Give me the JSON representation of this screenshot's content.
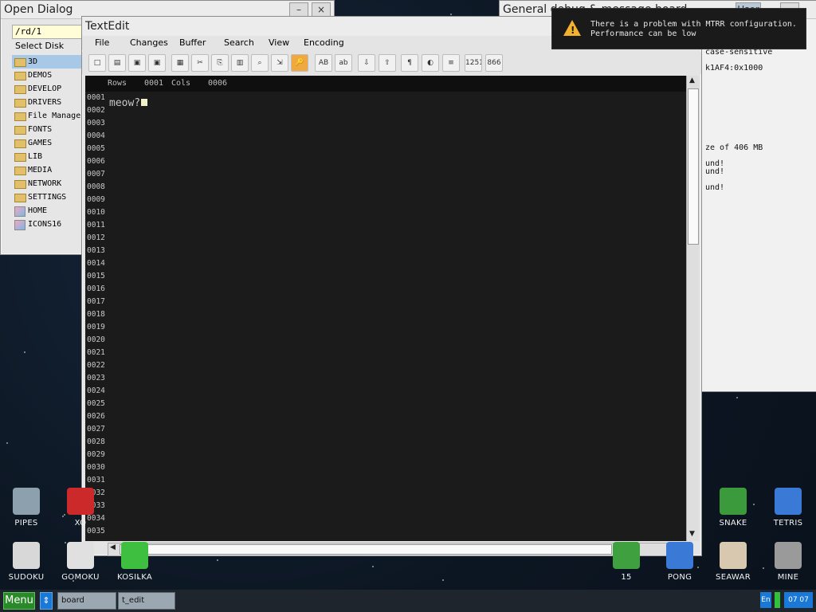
{
  "open_dialog": {
    "title": "Open Dialog",
    "path": "/rd/1",
    "select_disk": "Select Disk",
    "items": [
      {
        "name": "3D",
        "type": "folder",
        "selected": true
      },
      {
        "name": "DEMOS",
        "type": "folder"
      },
      {
        "name": "DEVELOP",
        "type": "folder"
      },
      {
        "name": "DRIVERS",
        "type": "folder"
      },
      {
        "name": "File Manage",
        "type": "folder"
      },
      {
        "name": "FONTS",
        "type": "folder"
      },
      {
        "name": "GAMES",
        "type": "folder"
      },
      {
        "name": "LIB",
        "type": "folder"
      },
      {
        "name": "MEDIA",
        "type": "folder"
      },
      {
        "name": "NETWORK",
        "type": "folder"
      },
      {
        "name": "SETTINGS",
        "type": "folder"
      },
      {
        "name": "HOME",
        "type": "image"
      },
      {
        "name": "ICONS16",
        "type": "image"
      }
    ]
  },
  "debug_board": {
    "title": "General debug & message board",
    "user_button": "User",
    "lines": [
      "case-sensitive",
      "",
      "k1AF4:0x1000",
      "",
      "",
      "",
      "",
      "",
      "",
      "",
      "",
      "",
      "ze of 406 MB",
      "",
      "und!",
      "und!",
      "",
      "und!"
    ]
  },
  "notification": {
    "line1": "There is a problem with MTRR configuration.",
    "line2": "Performance can be low",
    "icon": "warning-icon"
  },
  "textedit": {
    "title": "TextEdit",
    "menu": [
      "File",
      "Changes",
      "Buffer",
      "Search",
      "View",
      "Encoding"
    ],
    "toolbar": [
      {
        "name": "new-file-icon",
        "glyph": "□"
      },
      {
        "name": "open-file-icon",
        "glyph": "▤"
      },
      {
        "name": "save-icon",
        "glyph": "▣"
      },
      {
        "name": "save-as-icon",
        "glyph": "▣"
      },
      {
        "name": "select-all-icon",
        "glyph": "▦"
      },
      {
        "name": "cut-icon",
        "glyph": "✂"
      },
      {
        "name": "copy-icon",
        "glyph": "⎘"
      },
      {
        "name": "paste-icon",
        "glyph": "▥"
      },
      {
        "name": "find-icon",
        "glyph": "⌕"
      },
      {
        "name": "goto-line-icon",
        "glyph": "⇲"
      },
      {
        "name": "key-words-icon",
        "glyph": "🔑"
      },
      {
        "name": "uppercase-icon",
        "glyph": "AB"
      },
      {
        "name": "lowercase-icon",
        "glyph": "ab"
      },
      {
        "name": "fold-icon",
        "glyph": "⇩"
      },
      {
        "name": "unfold-icon",
        "glyph": "⇧"
      },
      {
        "name": "invisible-chars-icon",
        "glyph": "¶"
      },
      {
        "name": "color-scheme-icon",
        "glyph": "◐"
      },
      {
        "name": "syntax-icon",
        "glyph": "≡"
      },
      {
        "name": "encoding-1251-866-icon",
        "glyph": "1251\n866"
      },
      {
        "name": "encoding-866-1251-icon",
        "glyph": "866\n1251"
      }
    ],
    "status": {
      "rows_label": "Rows",
      "rows_value": "0001",
      "cols_label": "Cols",
      "cols_value": "0006"
    },
    "line_numbers": [
      "0001",
      "0002",
      "0003",
      "0004",
      "0005",
      "0006",
      "0007",
      "0008",
      "0009",
      "0010",
      "0011",
      "0012",
      "0013",
      "0014",
      "0015",
      "0016",
      "0017",
      "0018",
      "0019",
      "0020",
      "0021",
      "0022",
      "0023",
      "0024",
      "0025",
      "0026",
      "0027",
      "0028",
      "0029",
      "0030",
      "0031",
      "0032",
      "0033",
      "0034",
      "0035"
    ],
    "content": "meow?"
  },
  "desktop_icons": [
    {
      "label": "PIPES",
      "color": "#8ca0ae"
    },
    {
      "label": "XO",
      "color": "#cc2a2a"
    },
    {
      "label": "SNAKE",
      "color": "#3b9a3b"
    },
    {
      "label": "TETRIS",
      "color": "#3a7ad6"
    },
    {
      "label": "SUDOKU",
      "color": "#d8d8d8"
    },
    {
      "label": "GOMOKU",
      "color": "#e0e0e0"
    },
    {
      "label": "KOSILKA",
      "color": "#3fbf3f"
    },
    {
      "label": "15",
      "color": "#3fa03f"
    },
    {
      "label": "PONG",
      "color": "#3a7ad6"
    },
    {
      "label": "SEAWAR",
      "color": "#d8c8b0"
    },
    {
      "label": "MINE",
      "color": "#9a9a9a"
    }
  ],
  "taskbar": {
    "menu": "Menu",
    "tasks": [
      "board",
      "t_edit"
    ],
    "lang": "En",
    "clock": "07 07"
  }
}
